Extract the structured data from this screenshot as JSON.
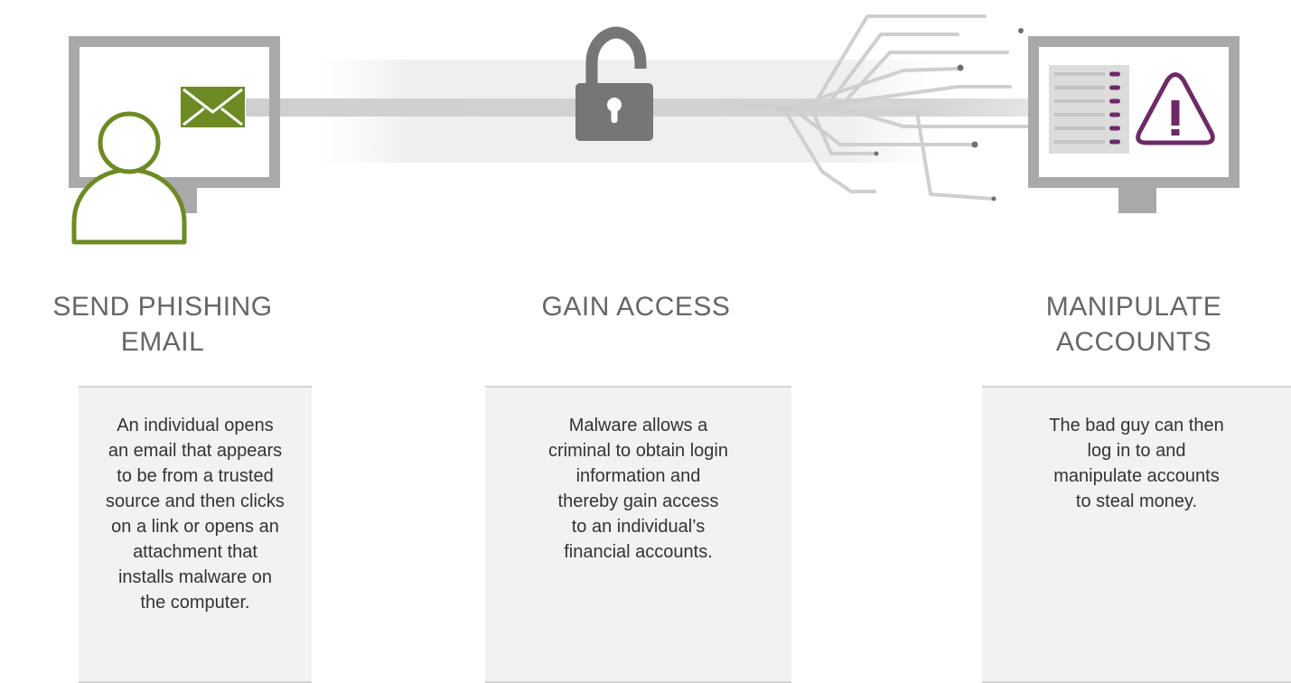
{
  "steps": [
    {
      "heading": "SEND PHISHING\nEMAIL",
      "description": "An individual opens an email that appears to be from a trusted source and then clicks on a link or opens an attachment that installs malware on the computer."
    },
    {
      "heading": "GAIN ACCESS",
      "description": "Malware allows a criminal to obtain login information and thereby gain access to an individual’s financial accounts."
    },
    {
      "heading": "MANIPULATE\nACCOUNTS",
      "description": "The bad guy can then log in to and manipulate accounts to steal money."
    }
  ],
  "icons": {
    "monitor": "monitor-icon",
    "person": "person-icon",
    "envelope": "envelope-icon",
    "lock": "open-padlock-icon",
    "circuit": "circuit-lines-icon",
    "warning": "warning-triangle-icon",
    "document": "document-list-icon"
  },
  "colors": {
    "gray": "#a9a9a9",
    "dark_gray": "#767676",
    "green": "#6e8a25",
    "purple": "#6e2a67",
    "card_bg": "#f2f2f2"
  }
}
